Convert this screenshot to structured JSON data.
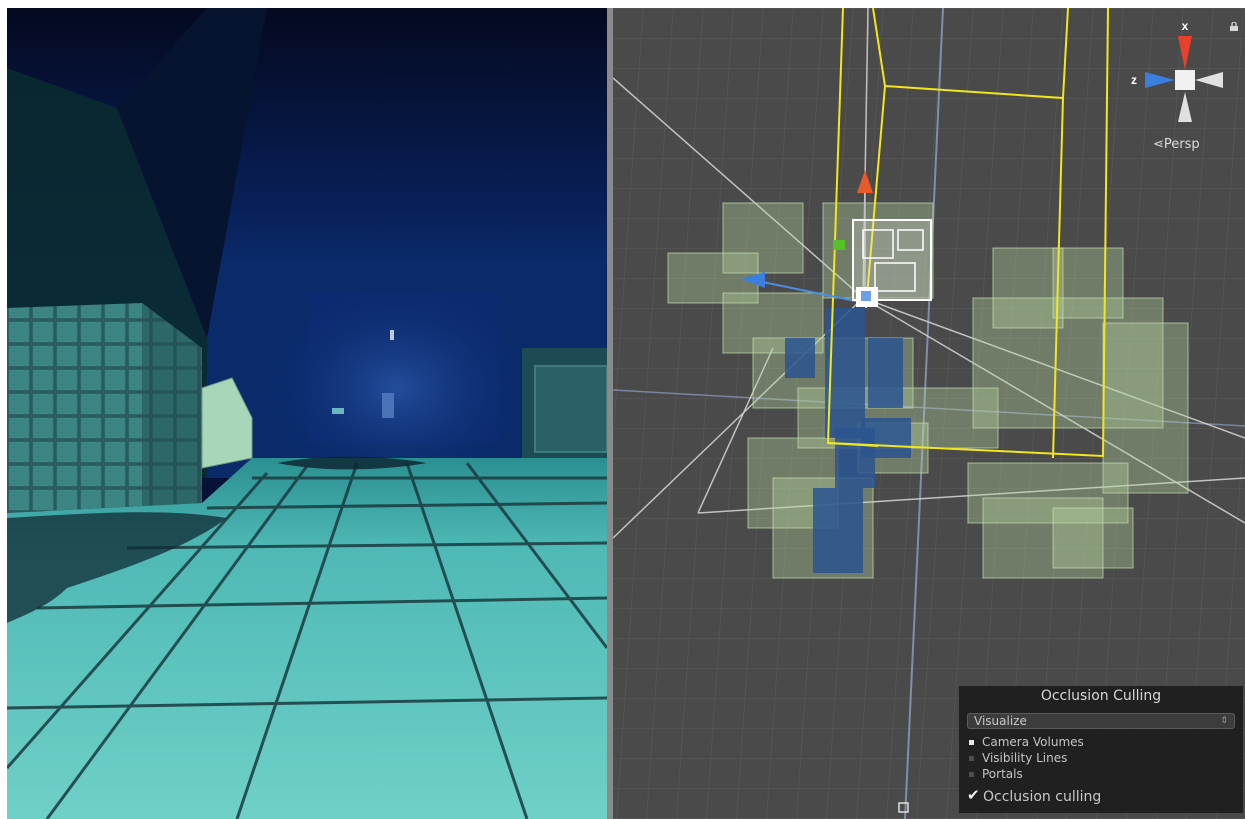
{
  "game_view": {
    "label": ""
  },
  "scene_view": {
    "gizmo": {
      "axis_x": "x",
      "axis_z": "z"
    },
    "projection_label": "Persp"
  },
  "occlusion_panel": {
    "title": "Occlusion Culling",
    "mode_select": {
      "value": "Visualize",
      "arrow": "⇕"
    },
    "items": [
      {
        "label": "Camera Volumes",
        "active": true
      },
      {
        "label": "Visibility Lines",
        "active": false
      },
      {
        "label": "Portals",
        "active": false
      }
    ],
    "checkbox": {
      "label": "Occlusion culling",
      "checked": true,
      "mark": "✔"
    }
  },
  "colors": {
    "scene_bg": "#4a4a4a",
    "grid": "#5e5e5e",
    "bounds_yellow": "#f2e61e",
    "volume_fill": "#b8d8a0",
    "occluder_blue": "#2a5590",
    "floor_cyan": "#55c6c0"
  }
}
